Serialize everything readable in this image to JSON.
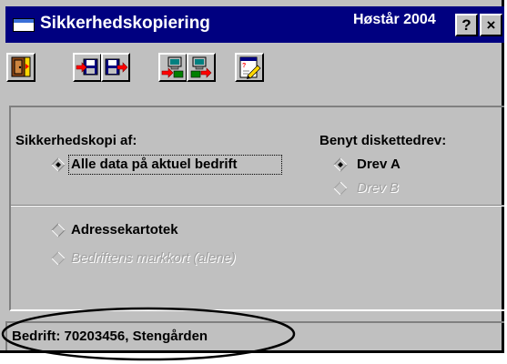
{
  "window": {
    "title": "Sikkerhedskopiering",
    "year_label": "Høstår 2004",
    "help_label": "?",
    "close_label": "×"
  },
  "toolbar": {
    "items": [
      {
        "icon": "exit-door-icon"
      },
      {
        "icon": "save-to-floppy-icon"
      },
      {
        "icon": "restore-from-floppy-icon"
      },
      {
        "icon": "network-transfer-icon"
      },
      {
        "icon": "network-transfer-alt-icon"
      },
      {
        "icon": "settings-edit-icon"
      }
    ]
  },
  "backup": {
    "heading": "Sikkerhedskopi af:",
    "options": [
      {
        "label": "Alle data på aktuel bedrift",
        "selected": true,
        "enabled": true
      },
      {
        "label": "Adressekartotek",
        "selected": false,
        "enabled": true
      },
      {
        "label": "Bedriftens markkort (alene)",
        "selected": false,
        "enabled": false
      }
    ]
  },
  "drive": {
    "heading": "Benyt diskettedrev:",
    "options": [
      {
        "label": "Drev A",
        "selected": true,
        "enabled": true
      },
      {
        "label": "Drev B",
        "selected": false,
        "enabled": false
      }
    ]
  },
  "status": {
    "text": "Bedrift: 70203456, Stengården"
  },
  "colors": {
    "titlebar": "#000080",
    "face": "#c0c0c0",
    "annotation": "#000000"
  }
}
